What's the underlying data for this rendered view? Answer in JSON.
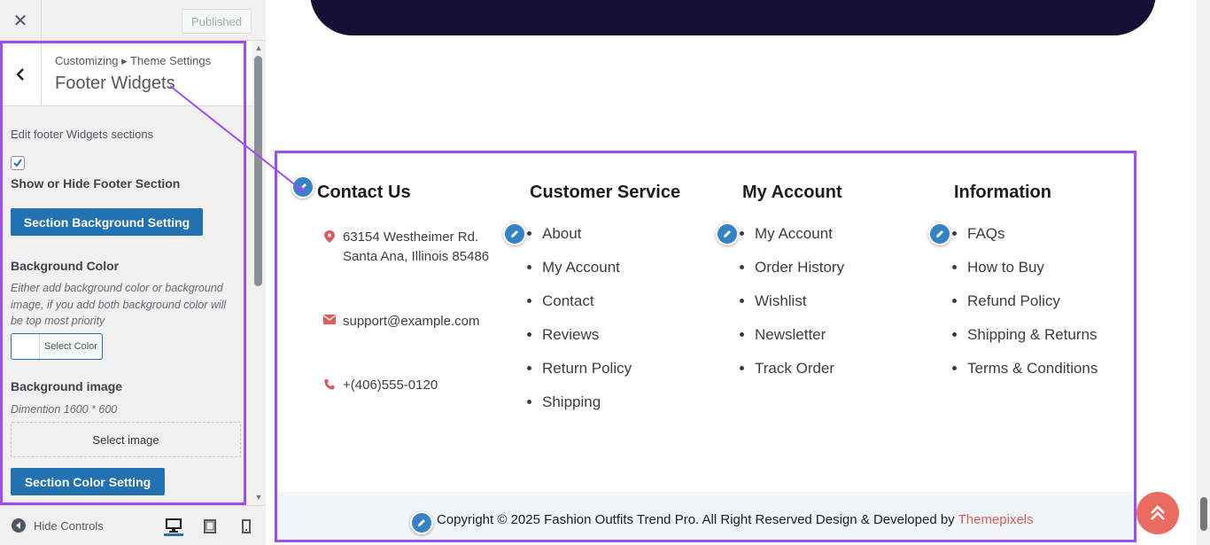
{
  "panel": {
    "close_icon": "close-icon",
    "publish_label": "Published",
    "breadcrumb": "Customizing ▸ Theme Settings",
    "section_title": "Footer Widgets",
    "description": "Edit footer Widgets sections",
    "show_hide_checked": true,
    "show_hide_label": "Show or Hide Footer Section",
    "bg_setting_button": "Section Background Setting",
    "bg_color_label": "Background Color",
    "bg_color_help": "Either add background color or background image, if you add both background color will be top most priority",
    "select_color_label": "Select Color",
    "bg_image_label": "Background image",
    "bg_image_dim": "Dimention 1600 * 600",
    "select_image_label": "Select image",
    "color_setting_button": "Section Color Setting",
    "hide_controls_label": "Hide Controls"
  },
  "footer": {
    "contact": {
      "title": "Contact Us",
      "address_line1": "63154 Westheimer Rd.",
      "address_line2": "Santa Ana, Illinois 85486",
      "email": "support@example.com",
      "phone": "+(406)555-0120"
    },
    "columns": [
      {
        "title": "Customer Service",
        "items": [
          "About",
          "My Account",
          "Contact",
          "Reviews",
          "Return Policy",
          "Shipping"
        ]
      },
      {
        "title": "My Account",
        "items": [
          "My Account",
          "Order History",
          "Wishlist",
          "Newsletter",
          "Track Order"
        ]
      },
      {
        "title": "Information",
        "items": [
          "FAQs",
          "How to Buy",
          "Refund Policy",
          "Shipping & Returns",
          "Terms & Conditions"
        ]
      }
    ],
    "copyright_text": "Copyright © 2025 Fashion Outfits Trend Pro. All Right Reserved Design & Developed by ",
    "copyright_link": "Themepixels"
  },
  "colors": {
    "highlight": "#9c4df4",
    "wp_button": "#2271b1",
    "edit_pin": "#3582c4",
    "back_to_top": "#ea6b61",
    "link": "#e05b5b",
    "hero": "#160f36"
  }
}
